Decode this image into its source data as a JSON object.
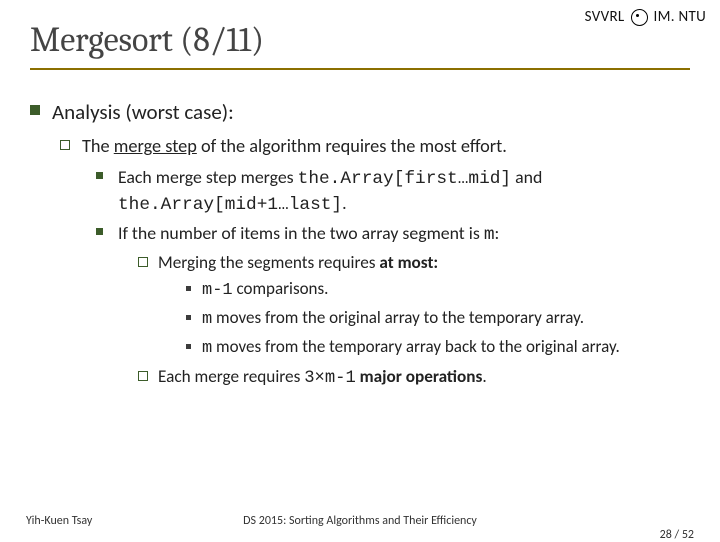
{
  "header": {
    "org": "SVVRL",
    "dept": "IM. NTU"
  },
  "title": "Mergesort (8/11)",
  "bullets": {
    "lv1_a": "Analysis (worst case):",
    "lv2_a_pre": "The ",
    "lv2_a_u": "merge step",
    "lv2_a_post": " of the algorithm requires the most effort.",
    "lv3_a_pre": "Each merge step merges ",
    "lv3_a_code1": "the.Array[first…mid]",
    "lv3_a_mid": " and ",
    "lv3_a_code2": "the.Array[mid+1…last]",
    "lv3_a_post": ".",
    "lv3_b_pre": "If the number of items in the two array segment is ",
    "lv3_b_code": "m",
    "lv3_b_post": ":",
    "lv4_a_pre": "Merging the segments requires ",
    "lv4_a_bold": "at most:",
    "lv5_a_code": "m-1",
    "lv5_a_rest": " comparisons.",
    "lv5_b_code": "m",
    "lv5_b_rest": " moves from the original array to the temporary array.",
    "lv5_c_code": "m",
    "lv5_c_rest": " moves from the temporary array back to the original array.",
    "lv4_b_pre": "Each merge requires ",
    "lv4_b_code": "3×m-1",
    "lv4_b_bold": " major operations",
    "lv4_b_post": "."
  },
  "footer": {
    "left": "Yih-Kuen Tsay",
    "center": "DS 2015: Sorting Algorithms and Their Efficiency",
    "right": "28 / 52"
  }
}
